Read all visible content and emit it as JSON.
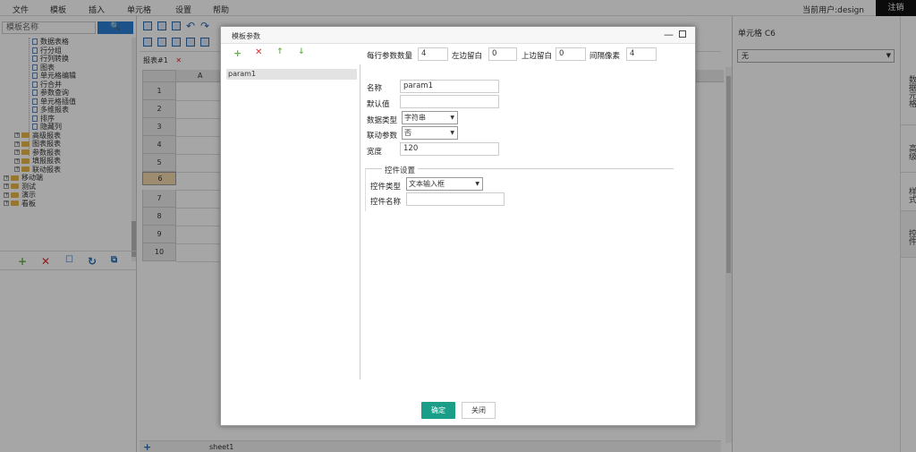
{
  "menu": [
    "文件",
    "模板",
    "插入",
    "单元格",
    "设置",
    "帮助"
  ],
  "user": "当前用户:design",
  "logout": "注销",
  "left": {
    "search_placeholder": "模板名称",
    "search_btn": "🔍",
    "tree": [
      {
        "label": "数据表格",
        "type": "doc",
        "depth": 2
      },
      {
        "label": "行分组",
        "type": "doc",
        "depth": 2
      },
      {
        "label": "行列转换",
        "type": "doc",
        "depth": 2
      },
      {
        "label": "图表",
        "type": "doc",
        "depth": 2
      },
      {
        "label": "单元格编辑",
        "type": "doc",
        "depth": 2
      },
      {
        "label": "行合并",
        "type": "doc",
        "depth": 2
      },
      {
        "label": "参数查询",
        "type": "doc",
        "depth": 2
      },
      {
        "label": "单元格插值",
        "type": "doc",
        "depth": 2
      },
      {
        "label": "多维报表",
        "type": "doc",
        "depth": 2
      },
      {
        "label": "排序",
        "type": "doc",
        "depth": 2
      },
      {
        "label": "隐藏列",
        "type": "doc",
        "depth": 2
      },
      {
        "label": "高级报表",
        "type": "folder",
        "depth": 1
      },
      {
        "label": "图表报表",
        "type": "folder",
        "depth": 1
      },
      {
        "label": "参数报表",
        "type": "folder",
        "depth": 1
      },
      {
        "label": "填报报表",
        "type": "folder",
        "depth": 1
      },
      {
        "label": "联动报表",
        "type": "folder",
        "depth": 1
      },
      {
        "label": "移动端",
        "type": "folder",
        "depth": 0
      },
      {
        "label": "测试",
        "type": "folder",
        "depth": 0
      },
      {
        "label": "演示",
        "type": "folder",
        "depth": 0
      },
      {
        "label": "看板",
        "type": "folder",
        "depth": 0
      }
    ]
  },
  "sheet": {
    "tab": "报表#1",
    "col_a": "A",
    "rows": [
      "1",
      "2",
      "3",
      "4",
      "5",
      "6",
      "7",
      "8",
      "9",
      "10"
    ],
    "selected_row": "6",
    "bottom_tab": "sheet1",
    "add": "+"
  },
  "right": {
    "title": "单元格 C6",
    "select_value": "无",
    "tabs": [
      "数据元格",
      "高级",
      "样式",
      "控件"
    ]
  },
  "dialog": {
    "title": "模板参数",
    "tools": {
      "add": "+",
      "del": "✕",
      "up": "↑",
      "down": "↓"
    },
    "params": [
      "param1"
    ],
    "top": {
      "per_row_label": "每行参数数量",
      "per_row": "4",
      "left_label": "左边留白",
      "left": "0",
      "top_label": "上边留白",
      "top": "0",
      "gap_label": "间隔像素",
      "gap": "4"
    },
    "name_label": "名称",
    "name": "param1",
    "default_label": "默认值",
    "default": "",
    "dtype_label": "数据类型",
    "dtype": "字符串",
    "linked_label": "联动参数",
    "linked": "否",
    "width_label": "宽度",
    "width": "120",
    "legend": "控件设置",
    "ctrl_type_label": "控件类型",
    "ctrl_type": "文本输入框",
    "ctrl_name_label": "控件名称",
    "ctrl_name": "",
    "ok": "确定",
    "close": "关闭"
  },
  "colors": {
    "accent": "#1a9e87",
    "search_btn": "#2a7fd4",
    "selected_row": "#f3d7ad"
  }
}
